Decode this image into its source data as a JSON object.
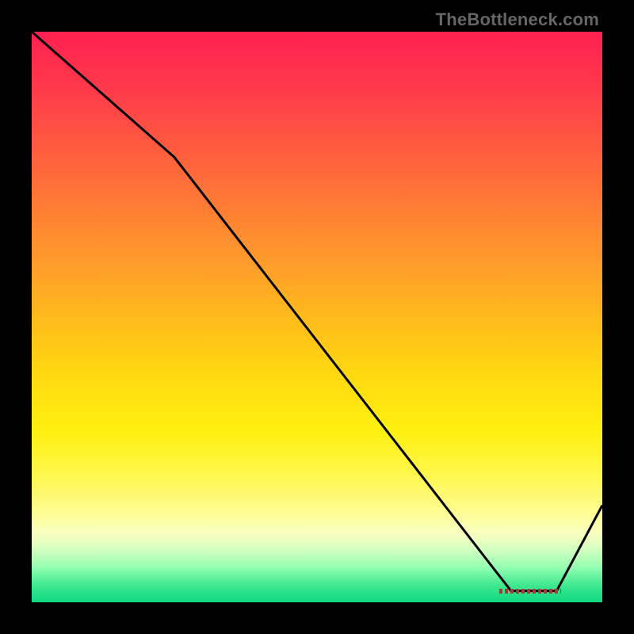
{
  "watermark": "TheBottleneck.com",
  "marker_label": "",
  "chart_data": {
    "type": "line",
    "title": "",
    "xlabel": "",
    "ylabel": "",
    "xlim": [
      0,
      100
    ],
    "ylim": [
      0,
      100
    ],
    "grid": false,
    "series": [
      {
        "name": "bottleneck-curve",
        "x": [
          0,
          25,
          84,
          92,
          100
        ],
        "values": [
          100,
          78,
          2,
          2,
          17
        ]
      }
    ],
    "annotations": [
      {
        "type": "optimal-zone",
        "x_range": [
          82,
          92
        ],
        "y": 2,
        "color": "#aa3a3a"
      }
    ],
    "colors": {
      "line": "#000000",
      "gradient_top": "#ff2050",
      "gradient_mid": "#ffee10",
      "gradient_bottom": "#10d880"
    }
  }
}
